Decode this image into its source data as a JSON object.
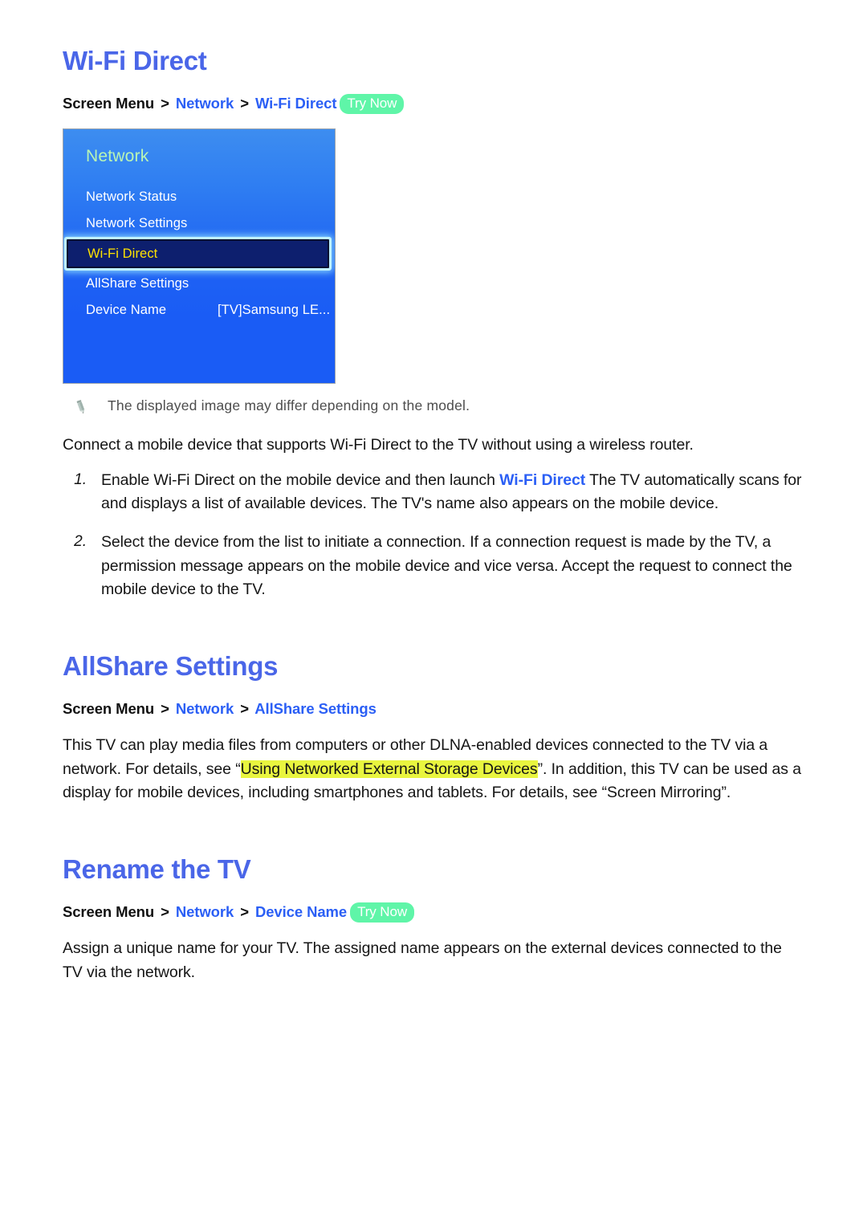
{
  "sections": [
    {
      "title": "Wi-Fi Direct",
      "breadcrumb": {
        "root": "Screen Menu",
        "sep": ">",
        "link1": "Network",
        "link2": "Wi-Fi Direct",
        "badge": "Try Now"
      },
      "tv_menu": {
        "title": "Network",
        "rows": [
          {
            "label": "Network Status",
            "value": "",
            "selected": false
          },
          {
            "label": "Network Settings",
            "value": "",
            "selected": false
          },
          {
            "label": "Wi-Fi Direct",
            "value": "",
            "selected": true
          },
          {
            "label": "AllShare Settings",
            "value": "",
            "selected": false
          },
          {
            "label": "Device Name",
            "value": "[TV]Samsung LE...",
            "selected": false
          }
        ]
      },
      "note": {
        "icon": "pencil-icon",
        "text": "The displayed image may differ depending on the model."
      },
      "intro": "Connect a mobile device that supports Wi-Fi Direct to the TV without using a wireless router.",
      "steps": [
        {
          "num": "1.",
          "text_before": "Enable Wi-Fi Direct on the mobile device and then launch ",
          "link": "Wi-Fi Direct",
          "text_after": " The TV automatically scans for and displays a list of available devices. The TV's name also appears on the mobile device."
        },
        {
          "num": "2.",
          "text_before": "Select the device from the list to initiate a connection. If a connection request is made by the TV, a permission message appears on the mobile device and vice versa. Accept the request to connect the mobile device to the TV.",
          "link": "",
          "text_after": ""
        }
      ]
    },
    {
      "title": "AllShare Settings",
      "breadcrumb": {
        "root": "Screen Menu",
        "sep": ">",
        "link1": "Network",
        "link2": "AllShare Settings",
        "badge": ""
      },
      "body_before": "This TV can play media files from computers or other DLNA-enabled devices connected to the TV via a network. For details, see “",
      "body_highlight": "Using Networked External Storage Devices",
      "body_after": "”. In addition, this TV can be used as a display for mobile devices, including smartphones and tablets. For details, see “Screen Mirroring”."
    },
    {
      "title": "Rename the TV",
      "breadcrumb": {
        "root": "Screen Menu",
        "sep": ">",
        "link1": "Network",
        "link2": "Device Name",
        "badge": "Try Now"
      },
      "body": "Assign a unique name for your TV. The assigned name appears on the external devices connected to the TV via the network."
    }
  ],
  "colors": {
    "heading": "#4a66e8",
    "link": "#2b5ff5",
    "try_now_bg": "#5ff5a8",
    "highlight": "#e9f53f",
    "menu_selected_text": "#ffe200",
    "menu_title": "#b9f5b4"
  }
}
